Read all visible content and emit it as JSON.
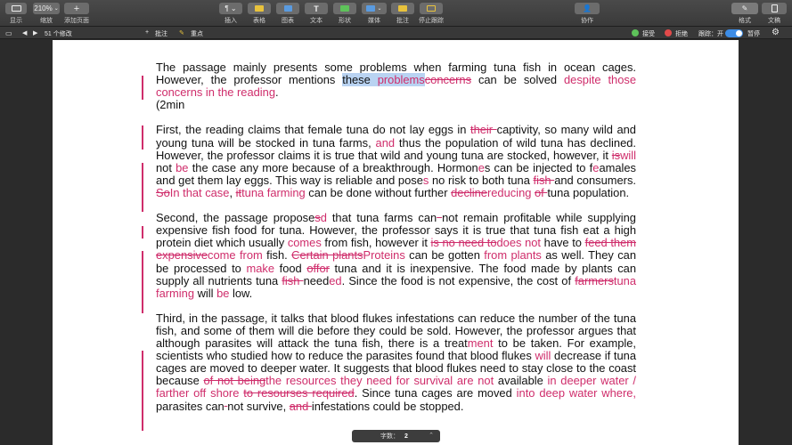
{
  "toolbar": {
    "view_label": "显示",
    "zoom_value": "210%",
    "zoom_label": "缩放",
    "add_page_label": "添加页面",
    "insert_label": "插入",
    "table_label": "表格",
    "chart_label": "图表",
    "text_label": "文本",
    "shape_label": "形状",
    "media_label": "媒体",
    "comment_label": "批注",
    "track_label": "停止跟踪",
    "collaborate_label": "协作",
    "format_label": "格式",
    "document_label": "文稿"
  },
  "trackbar": {
    "changes_count": "51 个修改",
    "comment_label": "批注",
    "highlight_label": "重点",
    "accept_label": "接受",
    "reject_label": "拒绝",
    "tracking_label": "跟踪：开",
    "pause_label": "暂停"
  },
  "footer": {
    "word_count_label": "字数：",
    "word_count_value": "2"
  }
}
